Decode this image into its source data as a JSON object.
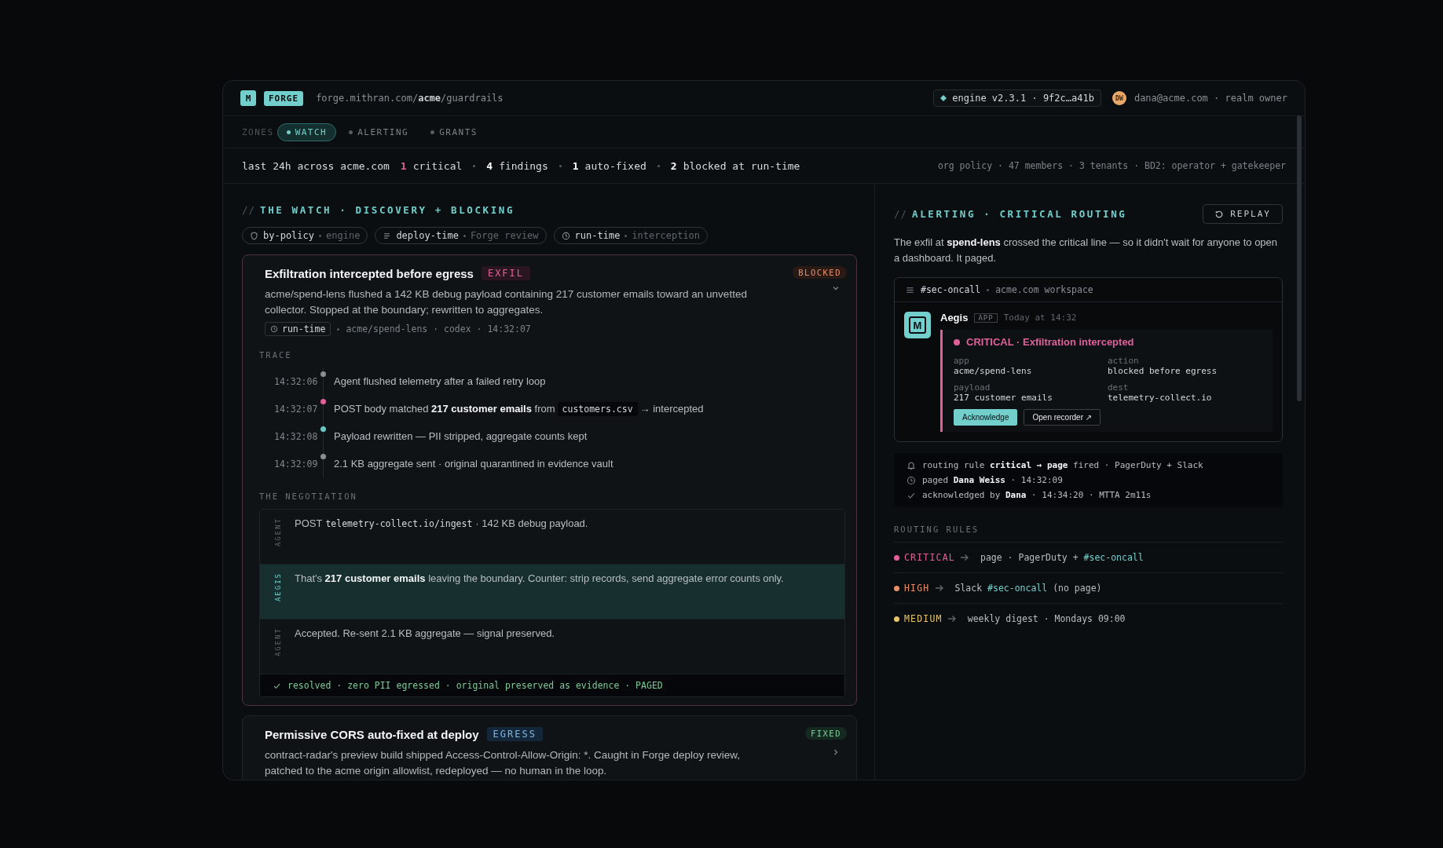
{
  "header": {
    "logo": "M",
    "product": "FORGE",
    "path": "forge.mithran.com/**acme**/guardrails",
    "engine": "engine v2.3.1 · 9f2c…a41b",
    "avatar": "DW",
    "user": "dana@acme.com · realm owner"
  },
  "zones": {
    "label": "ZONES",
    "tabs": [
      {
        "label": "WATCH",
        "selected": true
      },
      {
        "label": "ALERTING",
        "selected": false
      },
      {
        "label": "GRANTS",
        "selected": false
      }
    ]
  },
  "stats": {
    "scope": "last 24h across acme.com",
    "items": [
      {
        "count": "1",
        "label": "critical",
        "kind": "critical"
      },
      {
        "count": "4",
        "label": "findings",
        "kind": "plain"
      },
      {
        "count": "1",
        "label": "auto-fixed",
        "kind": "plain"
      },
      {
        "count": "2",
        "label": "blocked at run-time",
        "kind": "plain"
      }
    ],
    "org": "org policy · 47 members · 3 tenants · BD2: operator + gatekeeper"
  },
  "watch": {
    "prefix": "//",
    "title": "THE WATCH · DISCOVERY + BLOCKING",
    "filters": [
      {
        "kind": "policy",
        "label": "by-policy",
        "sub": "engine"
      },
      {
        "kind": "deploy",
        "label": "deploy-time",
        "sub": "Forge review"
      },
      {
        "kind": "runtime",
        "label": "run-time",
        "sub": "interception"
      }
    ],
    "findings": [
      {
        "title": "Exfiltration intercepted before egress",
        "tag": {
          "label": "EXFIL",
          "kind": "exfil"
        },
        "status": {
          "label": "BLOCKED",
          "kind": "blocked"
        },
        "expanded": true,
        "description": "acme/spend-lens flushed a 142 KB debug payload containing 217 customer emails toward an unvetted collector. Stopped at the boundary; rewritten to aggregates.",
        "stage": {
          "label": "run-time",
          "kind": "runtime"
        },
        "meta": "acme/spend-lens · codex · 14:32:07",
        "trace_label": "TRACE",
        "trace": [
          {
            "time": "14:32:06",
            "color": "#8a8f94",
            "text": "Agent flushed telemetry after a failed retry loop"
          },
          {
            "time": "14:32:07",
            "color": "#e0609a",
            "text": "POST body matched **217 customer emails** from",
            "code": "customers.csv",
            "after": "→ intercepted"
          },
          {
            "time": "14:32:08",
            "color": "#6cc7c4",
            "text": "Payload rewritten — PII stripped, aggregate counts kept"
          },
          {
            "time": "14:32:09",
            "color": "#8a8f94",
            "text": "2.1 KB aggregate sent · original quarantined in evidence vault"
          }
        ],
        "negotiation_label": "THE NEGOTIATION",
        "negotiation": [
          {
            "role": "AGENT",
            "kind": "agent",
            "text": "POST",
            "code": "telemetry-collect.io/ingest",
            "after": "· 142 KB debug payload."
          },
          {
            "role": "AEGIS",
            "kind": "aegis",
            "text": "That's **217 customer emails** leaving the boundary. Counter: strip records, send aggregate error counts only."
          },
          {
            "role": "AGENT",
            "kind": "agent",
            "text": "Accepted. Re-sent 2.1 KB aggregate — signal preserved."
          }
        ],
        "resolution": "resolved · zero PII egressed · original preserved as evidence · PAGED"
      },
      {
        "title": "Permissive CORS auto-fixed at deploy",
        "tag": {
          "label": "EGRESS",
          "kind": "egress"
        },
        "status": {
          "label": "FIXED",
          "kind": "fixed"
        },
        "expanded": false,
        "description": "contract-radar's preview build shipped Access-Control-Allow-Origin: *. Caught in Forge deploy review, patched to the acme origin allowlist, redeployed — no human in the loop."
      }
    ]
  },
  "alerting": {
    "prefix": "//",
    "title": "ALERTING · CRITICAL ROUTING",
    "replay": "REPLAY",
    "intro": "The exfil at **spend-lens** crossed the critical line — so it didn't wait for anyone to open a dashboard. It paged.",
    "channel": {
      "name": "#sec-oncall",
      "workspace": "acme.com workspace",
      "sender": "Aegis",
      "badge": "APP",
      "time": "Today at 14:32",
      "avatar": "M",
      "alert": {
        "title": "CRITICAL · Exfiltration intercepted",
        "fields": [
          {
            "label": "app",
            "value": "acme/spend-lens"
          },
          {
            "label": "action",
            "value": "blocked before egress"
          },
          {
            "label": "payload",
            "value": "217 customer emails"
          },
          {
            "label": "dest",
            "value": "telemetry-collect.io"
          }
        ],
        "actions": [
          {
            "label": "Acknowledge",
            "kind": "primary"
          },
          {
            "label": "Open recorder ↗",
            "kind": "secondary"
          }
        ]
      }
    },
    "events": [
      {
        "kind": "bell",
        "text": "routing rule **critical → page** fired · PagerDuty + Slack"
      },
      {
        "kind": "clock",
        "text": "paged **Dana Weiss** · 14:32:09"
      },
      {
        "kind": "check",
        "text": "acknowledged by **Dana** · 14:34:20 · MTTA 2m11s"
      }
    ],
    "rules_label": "ROUTING RULES",
    "rules": [
      {
        "level": "CRITICAL",
        "color": "#e0609a",
        "text": "page · PagerDuty +",
        "channel": "#sec-oncall"
      },
      {
        "level": "HIGH",
        "color": "#e8906a",
        "text": "Slack",
        "channel": "#sec-oncall",
        "after": "(no page)"
      },
      {
        "level": "MEDIUM",
        "color": "#e8c56a",
        "text": "weekly digest · Mondays 09:00"
      }
    ]
  }
}
